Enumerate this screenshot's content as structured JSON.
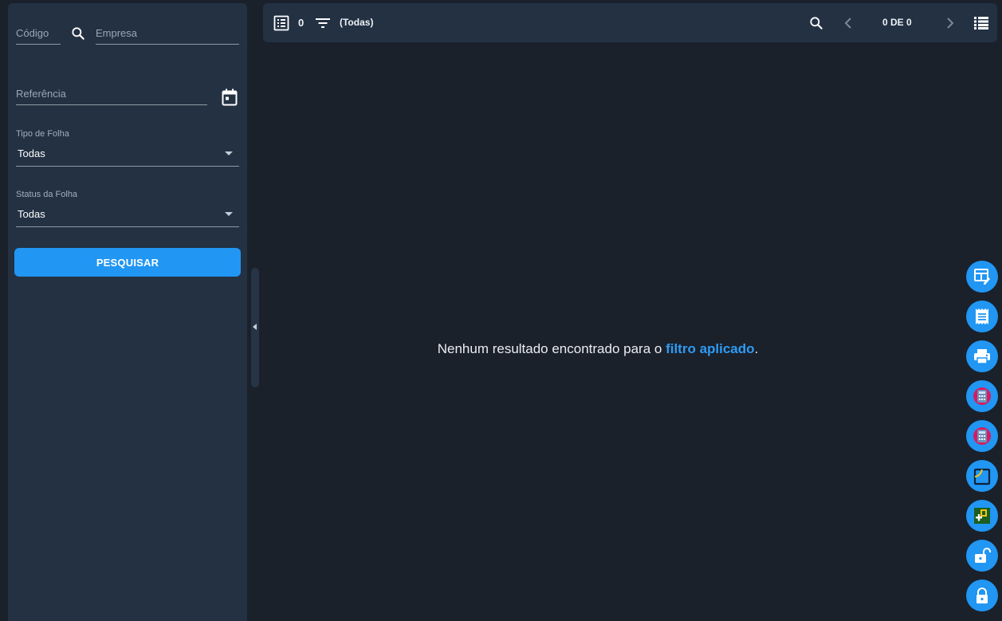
{
  "sidebar": {
    "codigo_label": "Código",
    "empresa_label": "Empresa",
    "referencia_label": "Referência",
    "tipo_folha": {
      "label": "Tipo de Folha",
      "value": "Todas"
    },
    "status_folha": {
      "label": "Status da Folha",
      "value": "Todas"
    },
    "search_button": "PESQUISAR"
  },
  "toolbar": {
    "count": "0",
    "filter_label": "(Todas)",
    "pagination": "0 DE 0"
  },
  "main": {
    "empty_prefix": "Nenhum resultado encontrado para o ",
    "empty_link": "filtro aplicado",
    "empty_suffix": "."
  },
  "fab_icons": [
    "edit-layout-icon",
    "receipt-icon",
    "print-icon",
    "calculator-icon",
    "calculator-icon",
    "export-icon",
    "add-report-icon",
    "unlock-icon",
    "lock-icon"
  ],
  "colors": {
    "accent": "#2196f3",
    "background": "#1a212b",
    "panel": "#233143",
    "link": "#2e9bf2"
  }
}
